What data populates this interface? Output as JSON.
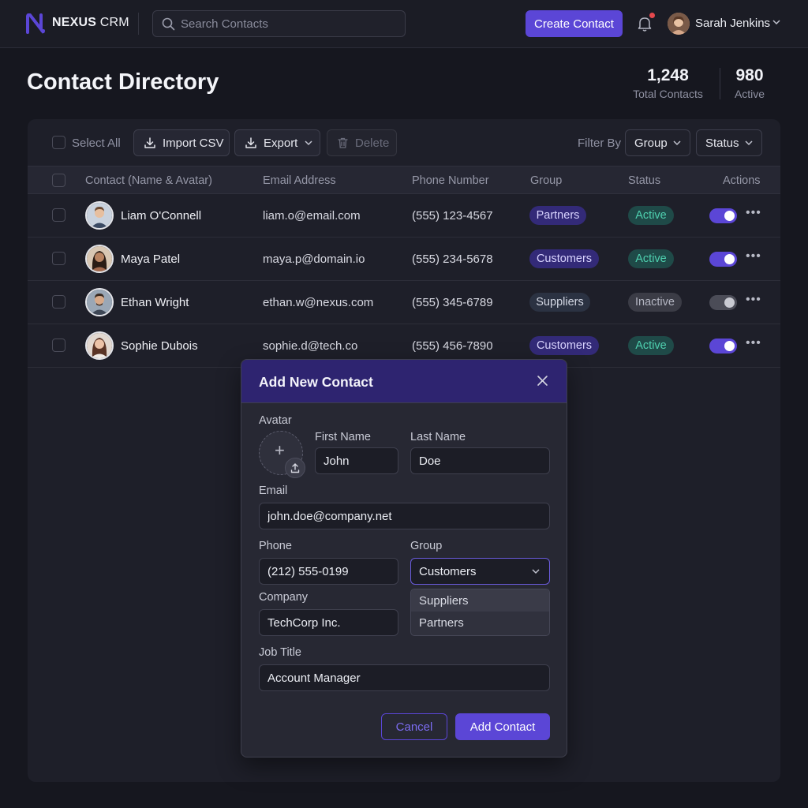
{
  "app": {
    "brand_bold": "NEXUS",
    "brand_rest": "CRM"
  },
  "topbar": {
    "search_placeholder": "Search Contacts",
    "create_label": "Create Contact",
    "user_name": "Sarah Jenkins",
    "notification_dot_color": "#e5484d"
  },
  "header": {
    "title": "Contact Directory",
    "stats": [
      {
        "value": "1,248",
        "label": "Total Contacts"
      },
      {
        "value": "980",
        "label": "Active"
      }
    ]
  },
  "toolbar": {
    "select_all": "Select All",
    "import_label": "Import CSV",
    "export_label": "Export",
    "delete_label": "Delete",
    "filter_label": "Filter By",
    "group_filter": "Group",
    "status_filter": "Status"
  },
  "table": {
    "columns": [
      "Contact (Name & Avatar)",
      "Email Address",
      "Phone Number",
      "Group",
      "Status",
      "Actions"
    ],
    "rows": [
      {
        "name": "Liam O'Connell",
        "email": "liam.o@email.com",
        "phone": "(555) 123-4567",
        "group": "Partners",
        "status": "Active",
        "enabled": true
      },
      {
        "name": "Maya Patel",
        "email": "maya.p@domain.io",
        "phone": "(555) 234-5678",
        "group": "Customers",
        "status": "Active",
        "enabled": true
      },
      {
        "name": "Ethan Wright",
        "email": "ethan.w@nexus.com",
        "phone": "(555) 345-6789",
        "group": "Suppliers",
        "status": "Inactive",
        "enabled": false
      },
      {
        "name": "Sophie Dubois",
        "email": "sophie.d@tech.co",
        "phone": "(555) 456-7890",
        "group": "Customers",
        "status": "Active",
        "enabled": true
      }
    ]
  },
  "modal": {
    "title": "Add New Contact",
    "avatar_label": "Avatar",
    "first_name_label": "First Name",
    "first_name_value": "John",
    "last_name_label": "Last Name",
    "last_name_value": "Doe",
    "email_label": "Email",
    "email_value": "john.doe@company.net",
    "phone_label": "Phone",
    "phone_value": "(212) 555-0199",
    "group_label": "Group",
    "group_value": "Customers",
    "group_options": [
      "Suppliers",
      "Partners"
    ],
    "company_label": "Company",
    "company_value": "TechCorp Inc.",
    "job_title_label": "Job Title",
    "job_title_value": "Account Manager",
    "cancel_label": "Cancel",
    "add_label": "Add Contact"
  },
  "colors": {
    "accent": "#5b46d6",
    "active_status": "#4fd1b0",
    "group_pill": "#332a78"
  }
}
